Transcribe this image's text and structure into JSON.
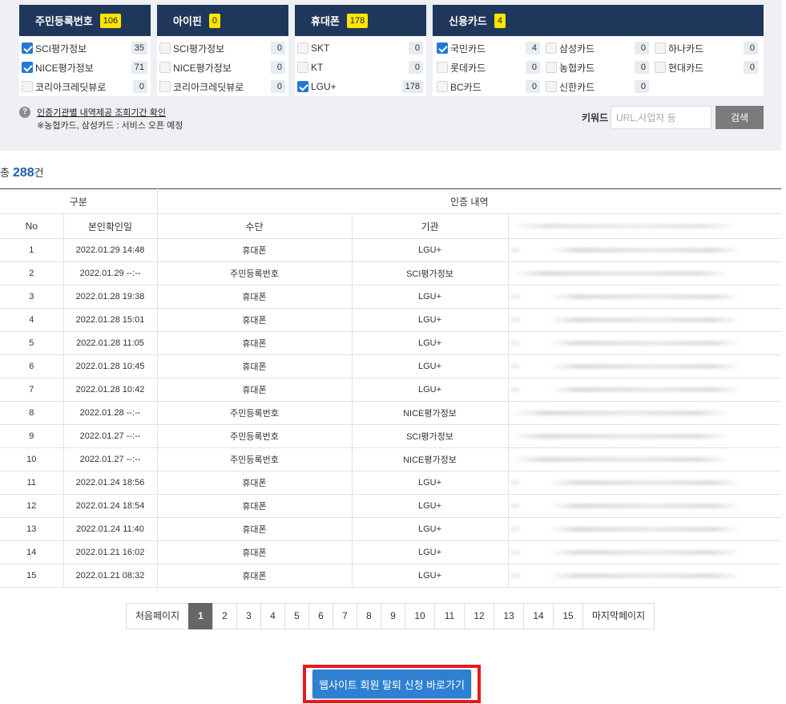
{
  "colors": {
    "header_bg": "#1f375a",
    "badge_bg": "#ffe500",
    "checkbox_checked": "#2577d9",
    "total_count": "#1d5fab",
    "active_page": "#666666",
    "search_button": "#7b7b7b",
    "withdraw_button": "#2f80d2",
    "annotation_outline": "#e8191c"
  },
  "icons": {
    "help": "question-circle-icon",
    "checkbox_checked": "check-icon"
  },
  "filters": [
    {
      "title": "주민등록번호",
      "badge": "106",
      "items": [
        {
          "label": "SCI평가정보",
          "count": "35",
          "checked": true
        },
        {
          "label": "NICE평가정보",
          "count": "71",
          "checked": true
        },
        {
          "label": "코리아크레딧뷰로",
          "count": "0",
          "checked": false
        }
      ]
    },
    {
      "title": "아이핀",
      "badge": "0",
      "items": [
        {
          "label": "SCI평가정보",
          "count": "0",
          "checked": false
        },
        {
          "label": "NICE평가정보",
          "count": "0",
          "checked": false
        },
        {
          "label": "코리아크레딧뷰로",
          "count": "0",
          "checked": false
        }
      ]
    },
    {
      "title": "휴대폰",
      "badge": "178",
      "items": [
        {
          "label": "SKT",
          "count": "0",
          "checked": false
        },
        {
          "label": "KT",
          "count": "0",
          "checked": false
        },
        {
          "label": "LGU+",
          "count": "178",
          "checked": true
        }
      ]
    },
    {
      "title": "신용카드",
      "badge": "4",
      "items": [
        {
          "label": "국민카드",
          "count": "4",
          "checked": true
        },
        {
          "label": "삼성카드",
          "count": "0",
          "checked": false
        },
        {
          "label": "하나카드",
          "count": "0",
          "checked": false
        },
        {
          "label": "롯데카드",
          "count": "0",
          "checked": false
        },
        {
          "label": "농협카드",
          "count": "0",
          "checked": false
        },
        {
          "label": "현대카드",
          "count": "0",
          "checked": false
        },
        {
          "label": "BC카드",
          "count": "0",
          "checked": false
        },
        {
          "label": "신한카드",
          "count": "0",
          "checked": false
        }
      ]
    }
  ],
  "info": {
    "link": "인증기관별 내역제공 조회기간 확인",
    "note": "※농협카드, 삼성카드 : 서비스 오픈 예정"
  },
  "search": {
    "label": "키워드",
    "placeholder": "URL,사업자 등",
    "button": "검색"
  },
  "total": {
    "prefix": "총",
    "count": "288",
    "suffix": "건"
  },
  "table": {
    "group_headers": [
      "구분",
      "인증 내역"
    ],
    "columns": [
      "No",
      "본인확인일",
      "수단",
      "기관"
    ],
    "rows": [
      {
        "no": "1",
        "date": "2022.01.29 14:48",
        "method": "휴대폰",
        "agency": "LGU+"
      },
      {
        "no": "2",
        "date": "2022.01.29 --:--",
        "method": "주민등록번호",
        "agency": "SCI평가정보"
      },
      {
        "no": "3",
        "date": "2022.01.28 19:38",
        "method": "휴대폰",
        "agency": "LGU+"
      },
      {
        "no": "4",
        "date": "2022.01.28 15:01",
        "method": "휴대폰",
        "agency": "LGU+"
      },
      {
        "no": "5",
        "date": "2022.01.28 11:05",
        "method": "휴대폰",
        "agency": "LGU+"
      },
      {
        "no": "6",
        "date": "2022.01.28 10:45",
        "method": "휴대폰",
        "agency": "LGU+"
      },
      {
        "no": "7",
        "date": "2022.01.28 10:42",
        "method": "휴대폰",
        "agency": "LGU+"
      },
      {
        "no": "8",
        "date": "2022.01.28 --:--",
        "method": "주민등록번호",
        "agency": "NICE평가정보"
      },
      {
        "no": "9",
        "date": "2022.01.27 --:--",
        "method": "주민등록번호",
        "agency": "SCI평가정보"
      },
      {
        "no": "10",
        "date": "2022.01.27 --:--",
        "method": "주민등록번호",
        "agency": "NICE평가정보"
      },
      {
        "no": "11",
        "date": "2022.01.24 18:56",
        "method": "휴대폰",
        "agency": "LGU+"
      },
      {
        "no": "12",
        "date": "2022.01.24 18:54",
        "method": "휴대폰",
        "agency": "LGU+"
      },
      {
        "no": "13",
        "date": "2022.01.24 11:40",
        "method": "휴대폰",
        "agency": "LGU+"
      },
      {
        "no": "14",
        "date": "2022.01.21 16:02",
        "method": "휴대폰",
        "agency": "LGU+"
      },
      {
        "no": "15",
        "date": "2022.01.21 08:32",
        "method": "휴대폰",
        "agency": "LGU+"
      }
    ]
  },
  "pagination": {
    "first": "처음페이지",
    "last": "마지막페이지",
    "pages": [
      {
        "label": "1",
        "current": true
      },
      {
        "label": "2"
      },
      {
        "label": "3"
      },
      {
        "label": "4"
      },
      {
        "label": "5"
      },
      {
        "label": "6"
      },
      {
        "label": "7"
      },
      {
        "label": "8"
      },
      {
        "label": "9"
      },
      {
        "label": "10"
      },
      {
        "label": "11"
      },
      {
        "label": "12"
      },
      {
        "label": "13"
      },
      {
        "label": "14"
      },
      {
        "label": "15"
      }
    ]
  },
  "withdraw": {
    "label": "웹사이트 회원 탈퇴 신청 바로가기"
  }
}
